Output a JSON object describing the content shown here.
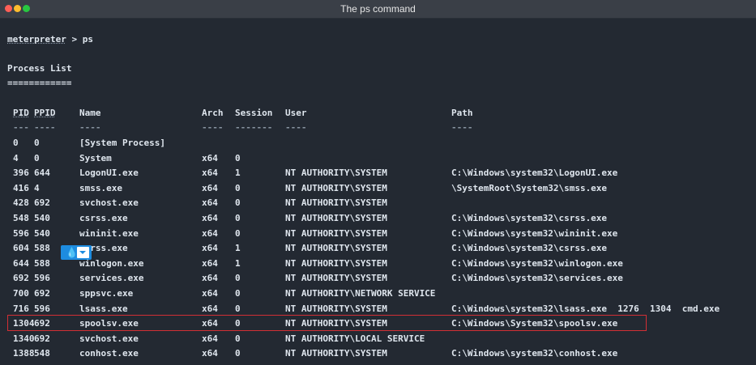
{
  "window": {
    "title": "The ps command"
  },
  "terminal": {
    "prompt_word": "meterpreter",
    "prompt_rest": " > ps",
    "heading": "Process List",
    "heading_rule": "============",
    "columns": {
      "pid": "PID",
      "ppid": "PPID",
      "name": "Name",
      "arch": "Arch",
      "session": "Session",
      "user": "User",
      "path": "Path"
    },
    "dashes": {
      "pid": "---",
      "ppid": "----",
      "name": "----",
      "arch": "----",
      "session": "-------",
      "user": "----",
      "path": "----"
    },
    "rows": [
      {
        "pid": "0",
        "ppid": "0",
        "name": "[System Process]",
        "arch": "",
        "session": "",
        "user": "",
        "path": ""
      },
      {
        "pid": "4",
        "ppid": "0",
        "name": "System",
        "arch": "x64",
        "session": "0",
        "user": "",
        "path": ""
      },
      {
        "pid": "396",
        "ppid": "644",
        "name": "LogonUI.exe",
        "arch": "x64",
        "session": "1",
        "user": "NT AUTHORITY\\SYSTEM",
        "path": "C:\\Windows\\system32\\LogonUI.exe"
      },
      {
        "pid": "416",
        "ppid": "4",
        "name": "smss.exe",
        "arch": "x64",
        "session": "0",
        "user": "NT AUTHORITY\\SYSTEM",
        "path": "\\SystemRoot\\System32\\smss.exe"
      },
      {
        "pid": "428",
        "ppid": "692",
        "name": "svchost.exe",
        "arch": "x64",
        "session": "0",
        "user": "NT AUTHORITY\\SYSTEM",
        "path": ""
      },
      {
        "pid": "548",
        "ppid": "540",
        "name": "csrss.exe",
        "arch": "x64",
        "session": "0",
        "user": "NT AUTHORITY\\SYSTEM",
        "path": "C:\\Windows\\system32\\csrss.exe"
      },
      {
        "pid": "596",
        "ppid": "540",
        "name": "wininit.exe",
        "arch": "x64",
        "session": "0",
        "user": "NT AUTHORITY\\SYSTEM",
        "path": "C:\\Windows\\system32\\wininit.exe"
      },
      {
        "pid": "604",
        "ppid": "588",
        "name": "csrss.exe",
        "arch": "x64",
        "session": "1",
        "user": "NT AUTHORITY\\SYSTEM",
        "path": "C:\\Windows\\system32\\csrss.exe"
      },
      {
        "pid": "644",
        "ppid": "588",
        "name": "winlogon.exe",
        "arch": "x64",
        "session": "1",
        "user": "NT AUTHORITY\\SYSTEM",
        "path": "C:\\Windows\\system32\\winlogon.exe"
      },
      {
        "pid": "692",
        "ppid": "596",
        "name": "services.exe",
        "arch": "x64",
        "session": "0",
        "user": "NT AUTHORITY\\SYSTEM",
        "path": "C:\\Windows\\system32\\services.exe"
      },
      {
        "pid": "700",
        "ppid": "692",
        "name": "sppsvc.exe",
        "arch": "x64",
        "session": "0",
        "user": "NT AUTHORITY\\NETWORK SERVICE",
        "path": ""
      },
      {
        "pid": "716",
        "ppid": "596",
        "name": "lsass.exe",
        "arch": "x64",
        "session": "0",
        "user": "NT AUTHORITY\\SYSTEM",
        "path": "C:\\Windows\\system32\\lsass.exe  1276  1304  cmd.exe"
      },
      {
        "pid": "1304",
        "ppid": "692",
        "name": "spoolsv.exe",
        "arch": "x64",
        "session": "0",
        "user": "NT AUTHORITY\\SYSTEM",
        "path": "C:\\Windows\\System32\\spoolsv.exe"
      },
      {
        "pid": "1340",
        "ppid": "692",
        "name": "svchost.exe",
        "arch": "x64",
        "session": "0",
        "user": "NT AUTHORITY\\LOCAL SERVICE",
        "path": ""
      },
      {
        "pid": "1388",
        "ppid": "548",
        "name": "conhost.exe",
        "arch": "x64",
        "session": "0",
        "user": "NT AUTHORITY\\SYSTEM",
        "path": "C:\\Windows\\system32\\conhost.exe"
      }
    ]
  },
  "colors": {
    "background": "#232932",
    "highlight_border": "#d22f35",
    "overlay_accent": "#1d8ce0"
  },
  "icons": {
    "overlay_left": "water-drop-icon",
    "overlay_right": "dropdown-card-icon"
  }
}
